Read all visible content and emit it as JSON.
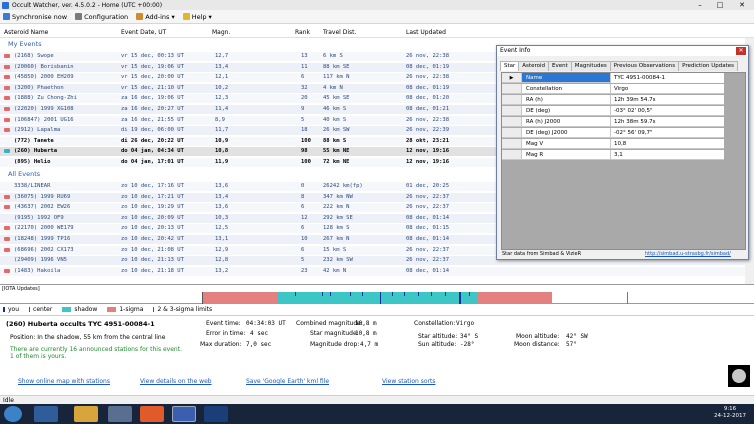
{
  "window": {
    "title": "Occult Watcher, ver. 4.5.0.2 - Home (UTC +00:00)"
  },
  "menu": {
    "synchronise": "Synchronise now",
    "configuration": "Configuration",
    "addins": "Add-ins",
    "help": "Help"
  },
  "columns": [
    "Asteroid Name",
    "Event Date, UT",
    "Magn.",
    "Rank",
    "Travel Dist.",
    "Last Updated"
  ],
  "sections": {
    "my_events": "My Events",
    "all_events": "All Events"
  },
  "my_events": [
    {
      "name": "(2168) Swope",
      "date": "vr 15 dec, 00:13 UT",
      "mag": "12,7",
      "rank": "13",
      "dist": "6 km S",
      "updated": "26 nov, 22:38",
      "mark": "#e36a6a",
      "bold": false
    },
    {
      "name": "(20060) Borisbanin",
      "date": "vr 15 dec, 19:06 UT",
      "mag": "13,4",
      "rank": "11",
      "dist": "88 km SE",
      "updated": "08 dec, 01:19",
      "mark": "#e36a6a",
      "bold": false
    },
    {
      "name": "(45850) 2000 EH209",
      "date": "vr 15 dec, 20:00 UT",
      "mag": "12,1",
      "rank": "6",
      "dist": "117 km N",
      "updated": "26 nov, 22:38",
      "mark": "#e36a6a",
      "bold": false
    },
    {
      "name": "(3200) Phaethon",
      "date": "vr 15 dec, 21:10 UT",
      "mag": "10,2",
      "rank": "32",
      "dist": "4 km N",
      "updated": "08 dec, 01:19",
      "mark": "#e36a6a",
      "bold": false
    },
    {
      "name": "(1888) Zu Chong-Zhi",
      "date": "za 16 dec, 19:06 UT",
      "mag": "12,3",
      "rank": "20",
      "dist": "45 km SE",
      "updated": "08 dec, 01:20",
      "mark": "#e36a6a",
      "bold": false
    },
    {
      "name": "(22020) 1999 XG108",
      "date": "za 16 dec, 20:27 UT",
      "mag": "11,4",
      "rank": "9",
      "dist": "46 km S",
      "updated": "08 dec, 01:21",
      "mark": "#e36a6a",
      "bold": false
    },
    {
      "name": "(106847) 2001 UG16",
      "date": "za 16 dec, 21:55 UT",
      "mag": "8,9",
      "rank": "5",
      "dist": "40 km S",
      "updated": "26 nov, 22:38",
      "mark": "#e36a6a",
      "bold": false
    },
    {
      "name": "(2912) Lapalma",
      "date": "di 19 dec, 06:00 UT",
      "mag": "11,7",
      "rank": "18",
      "dist": "26 km SW",
      "updated": "26 nov, 22:39",
      "mark": "#e36a6a",
      "bold": false
    },
    {
      "name": "(772) Tanete",
      "date": "di 26 dec, 20:22 UT",
      "mag": "10,9",
      "rank": "100",
      "dist": "88 km S",
      "updated": "28 okt, 23:21",
      "mark": "",
      "bold": true
    },
    {
      "name": "(260) Huberta",
      "date": "do 04 jan, 04:34 UT",
      "mag": "10,8",
      "rank": "98",
      "dist": "55 km NE",
      "updated": "12 nov, 19:16",
      "mark": "#3cb0c8",
      "bold": true
    },
    {
      "name": "(895) Helio",
      "date": "do 04 jan, 17:01 UT",
      "mag": "11,9",
      "rank": "100",
      "dist": "72 km NE",
      "updated": "12 nov, 19:16",
      "mark": "",
      "bold": true
    }
  ],
  "all_events": [
    {
      "name": "3338/LINEAR",
      "date": "zo 10 dec, 17:16 UT",
      "mag": "13,6",
      "rank": "0",
      "dist": "26242 km(fp)",
      "updated": "01 dec, 20:25",
      "mark": ""
    },
    {
      "name": "(36075) 1999 RU69",
      "date": "zo 10 dec, 17:21 UT",
      "mag": "13,4",
      "rank": "8",
      "dist": "347 km NW",
      "updated": "26 nov, 22:37",
      "mark": "#e36a6a"
    },
    {
      "name": "(43637) 2002 EW26",
      "date": "zo 10 dec, 19:29 UT",
      "mag": "13,6",
      "rank": "6",
      "dist": "222 km N",
      "updated": "26 nov, 22:37",
      "mark": "#e36a6a"
    },
    {
      "name": "(9195) 1992 OF9",
      "date": "zo 10 dec, 20:09 UT",
      "mag": "10,3",
      "rank": "12",
      "dist": "292 km SE",
      "updated": "08 dec, 01:14",
      "mark": ""
    },
    {
      "name": "(22170) 2000 WE179",
      "date": "zo 10 dec, 20:13 UT",
      "mag": "12,5",
      "rank": "6",
      "dist": "128 km S",
      "updated": "08 dec, 01:15",
      "mark": "#e36a6a"
    },
    {
      "name": "(18248) 1999 TP16",
      "date": "zo 10 dec, 20:42 UT",
      "mag": "13,1",
      "rank": "10",
      "dist": "267 km N",
      "updated": "08 dec, 01:14",
      "mark": "#e36a6a"
    },
    {
      "name": "(68696) 2002 CX173",
      "date": "zo 10 dec, 21:08 UT",
      "mag": "12,9",
      "rank": "6",
      "dist": "15 km S",
      "updated": "26 nov, 22:37",
      "mark": "#e36a6a"
    },
    {
      "name": "(29409) 1996 VN5",
      "date": "zo 10 dec, 21:13 UT",
      "mag": "12,8",
      "rank": "5",
      "dist": "232 km SW",
      "updated": "26 nov, 22:37",
      "mark": ""
    },
    {
      "name": "(1483) Hakoila",
      "date": "zo 10 dec, 21:18 UT",
      "mag": "13,2",
      "rank": "23",
      "dist": "42 km N",
      "updated": "08 dec, 01:14",
      "mark": "#e36a6a"
    }
  ],
  "dialog": {
    "title": "Event Info",
    "tabs": [
      "Star",
      "Asteroid",
      "Event",
      "Magnitudes",
      "Previous Observations",
      "Prediction Updates"
    ],
    "rows": [
      {
        "k": "Name",
        "v": "TYC 4951-00084-1"
      },
      {
        "k": "Constellation",
        "v": "Virgo"
      },
      {
        "k": "RA (h)",
        "v": "12h 39m 54.7s"
      },
      {
        "k": "DE (deg)",
        "v": "-03° 02' 00,5\""
      },
      {
        "k": "RA (h) J2000",
        "v": "12h 38m 59.7s"
      },
      {
        "k": "DE (deg) J2000",
        "v": "-02° 56' 09,7\""
      },
      {
        "k": "Mag V",
        "v": "10,8"
      },
      {
        "k": "Mag R",
        "v": "3,1"
      }
    ],
    "footer": "Star data from Simbad & VizieR",
    "link": "http://simbad.u-strasbg.fr/simbad/"
  },
  "timeline": {
    "header": "[IOTA Updates]",
    "legend": [
      "you",
      "center",
      "shadow",
      "1-sigma",
      "2 & 3-sigma limits"
    ],
    "colors": {
      "shadow": "#3cc6c6",
      "sigma1": "#e48080",
      "center": "#1030a0"
    }
  },
  "detail": {
    "title": "(260) Huberta occults TYC 4951-00084-1",
    "position": "Position:   In the shadow, 55 km from the central line",
    "announced": "There are currently 16 announced stations for this event.",
    "yours": "1 of them is yours.",
    "event_time_label": "Event time:",
    "event_time": "04:34:03 UT",
    "error_label": "Error in time:",
    "error": "4 sec",
    "max_dur_label": "Max duration:",
    "max_dur": "7,0 sec",
    "comb_mag_label": "Combined magnitude:",
    "comb_mag": "10,8 m",
    "star_mag_label": "Star magnitude:",
    "star_mag": "10,8 m",
    "mag_drop_label": "Magnitude drop:",
    "mag_drop": "4,7 m",
    "const_label": "Constellation:",
    "const": "Virgo",
    "star_alt_label": "Star altitude:",
    "star_alt": "34° S",
    "sun_alt_label": "Sun altitude:",
    "sun_alt": "-28°",
    "moon_alt_label": "Moon altitude:",
    "moon_alt": "42° SW",
    "moon_dist_label": "Moon distance:",
    "moon_dist": "57°",
    "links": [
      "Show online map with stations",
      "View details on the web",
      "Save 'Google Earth' kml file",
      "View station sorts"
    ]
  },
  "status": {
    "text": "Idle"
  },
  "taskbar": {
    "time": "9:16",
    "date": "24-12-2017"
  }
}
